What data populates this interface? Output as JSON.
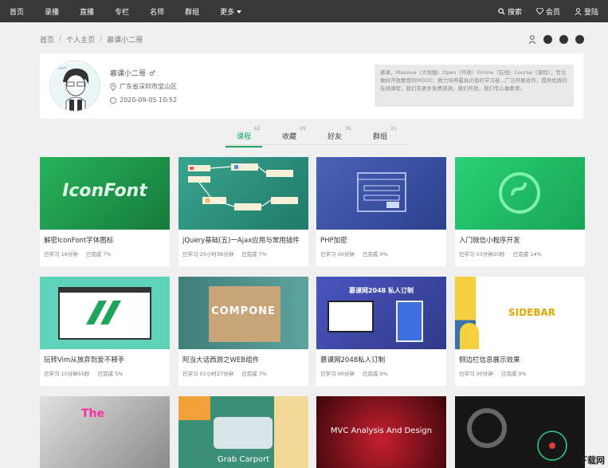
{
  "nav": {
    "left": [
      "首页",
      "录播",
      "直播",
      "专栏",
      "名师",
      "群组",
      "更多"
    ],
    "right": [
      "搜索",
      "会员",
      "登陆"
    ]
  },
  "breadcrumb": [
    "首页",
    "个人主页",
    "慕课小二哥"
  ],
  "profile": {
    "name": "慕课小二哥",
    "gender_symbol": "♂",
    "location": "广东省深圳市宝山区",
    "date": "2020-09-05 10:52",
    "intro": "慕课，Massive（大规模）Open（开放）Online（在线）Course（课程），专注做好开放教育的MOOC，致力培养最具价值的学习者...广泛开展合作，提供优质的在线课程，我们有更多免费资源，我们开放，我们专心做教育。"
  },
  "tabs": [
    {
      "label": "课程",
      "count": "62"
    },
    {
      "label": "收藏",
      "count": "29"
    },
    {
      "label": "好友",
      "count": "36"
    },
    {
      "label": "群组",
      "count": "31"
    }
  ],
  "courses": [
    {
      "title": "解密IconFont字体图标",
      "studied": "已学习 18分钟",
      "done": "已完成 7%",
      "thumb_text": "IconFont",
      "bg": "#1f9a4b"
    },
    {
      "title": "jQuery基础(五)一Ajax应用与常用插件",
      "studied": "已学习 20小时36分钟",
      "done": "已完成 7%",
      "thumb_text": "",
      "bg": "#2a8f7d"
    },
    {
      "title": "PHP加密",
      "studied": "已学习 00分钟",
      "done": "已完成 0%",
      "thumb_text": "",
      "bg": "#3c54a6"
    },
    {
      "title": "入门微信小程序开发",
      "studied": "已学习 03分钟20秒",
      "done": "已完成 14%",
      "thumb_text": "",
      "bg": "#22c46a"
    },
    {
      "title": "玩转Vim从放弃到爱不释手",
      "studied": "已学习 10分钟55秒",
      "done": "已完成 5%",
      "thumb_text": "",
      "bg": "#52cfb4"
    },
    {
      "title": "阿当大话西游之WEB组件",
      "studied": "已学习 01小时27分钟",
      "done": "已完成 7%",
      "thumb_text": "COMPONE",
      "bg": "#4b8f8a"
    },
    {
      "title": "慕课网2048私人订制",
      "studied": "已学习 00分钟",
      "done": "已完成 0%",
      "thumb_text": "慕课网2048 私人订制",
      "bg": "#4a52b8"
    },
    {
      "title": "侧边栏信息展示效果",
      "studied": "已学习 00分钟",
      "done": "已完成 0%",
      "thumb_text": "SIDEBAR",
      "bg": "#ffffff"
    },
    {
      "title": "",
      "studied": "",
      "done": "",
      "thumb_text": "The",
      "bg": "#bdbdbd"
    },
    {
      "title": "",
      "studied": "",
      "done": "",
      "thumb_text": "Grab  Carport",
      "bg": "#3b8f77"
    },
    {
      "title": "",
      "studied": "",
      "done": "",
      "thumb_text": "MVC Analysis And Design",
      "bg": "#5a0f16"
    },
    {
      "title": "",
      "studied": "",
      "done": "",
      "thumb_text": "",
      "bg": "#1a1a1a"
    }
  ],
  "watermark": "下载网"
}
